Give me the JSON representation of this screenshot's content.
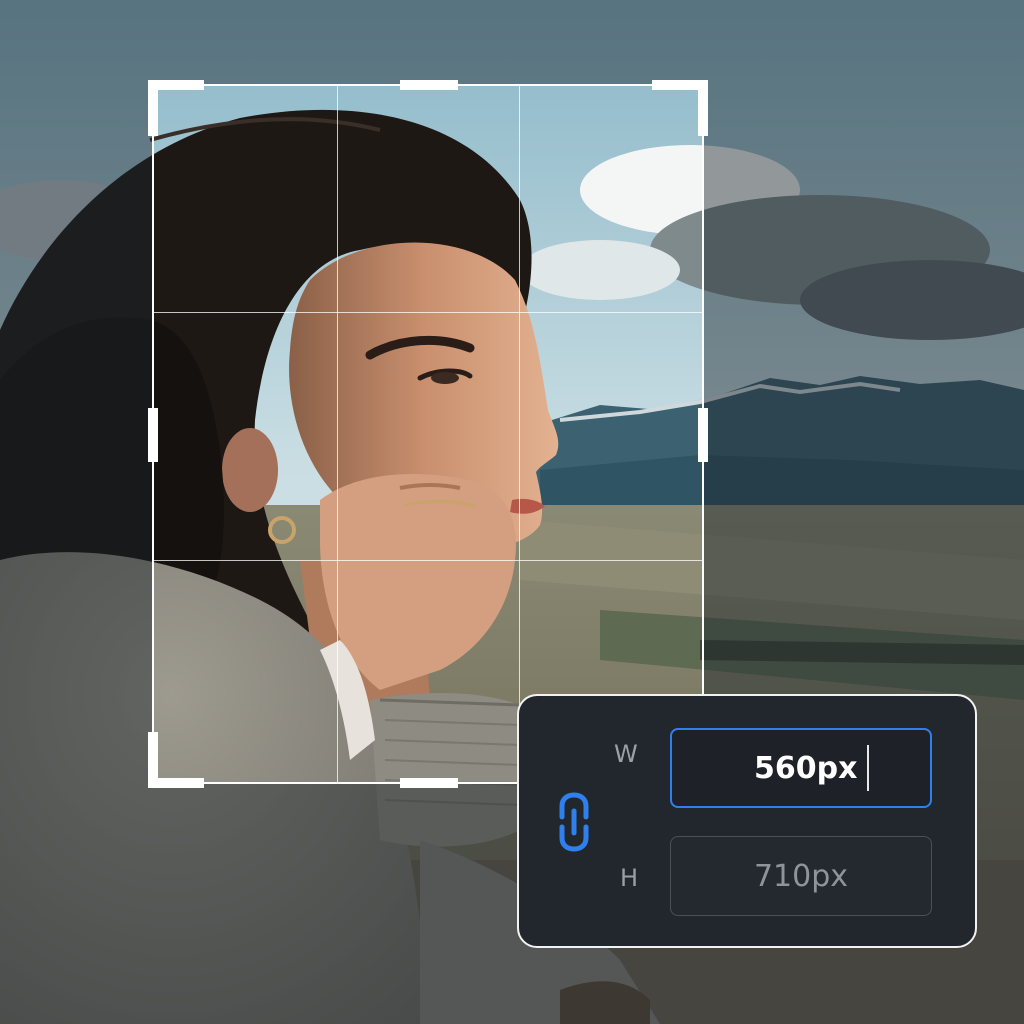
{
  "crop_tool": {
    "grid": "rule-of-thirds"
  },
  "size_panel": {
    "width_label": "W",
    "height_label": "H",
    "width_value": "560px",
    "height_value": "710px",
    "link_icon": "link-icon",
    "active_field": "width"
  },
  "colors": {
    "accent": "#2f80ed",
    "panel_background": "#22272e",
    "panel_border": "#f2f2f2",
    "label_text": "#9aa0a6",
    "inactive_value": "#8e949a",
    "active_value": "#ffffff"
  }
}
